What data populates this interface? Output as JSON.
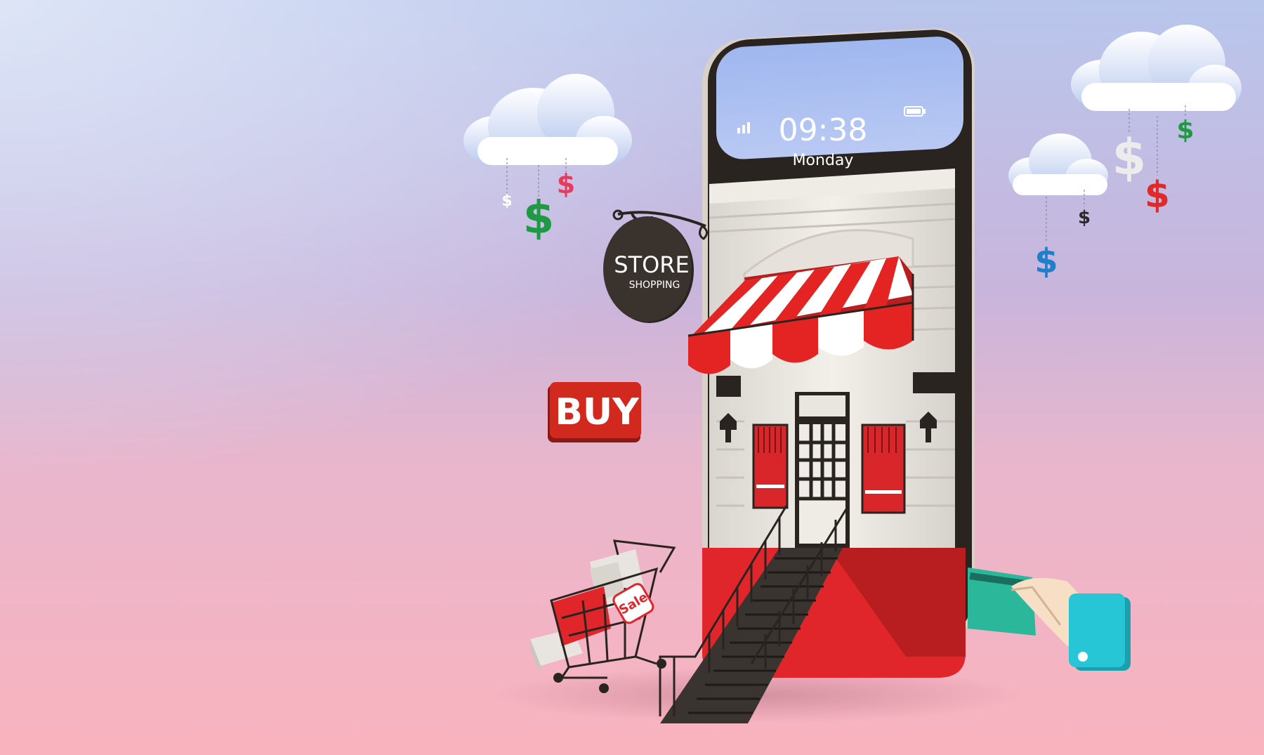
{
  "phone": {
    "time": "09:38",
    "day": "Monday"
  },
  "sign": {
    "title": "STORE",
    "subtitle": "SHOPPING"
  },
  "buy_sign": {
    "label": "BUY"
  },
  "cart": {
    "tag_label": "Sale"
  },
  "currency_symbol": "$",
  "colors": {
    "awning_red": "#e32422",
    "store_base_red": "#e0262a",
    "buy_red": "#d2291f",
    "dollar_green": "#1f9a44",
    "dollar_blue": "#1f7fc8",
    "dollar_pink": "#e83b5c",
    "card_teal": "#2bb89a",
    "sleeve_cyan": "#26c6d6"
  }
}
